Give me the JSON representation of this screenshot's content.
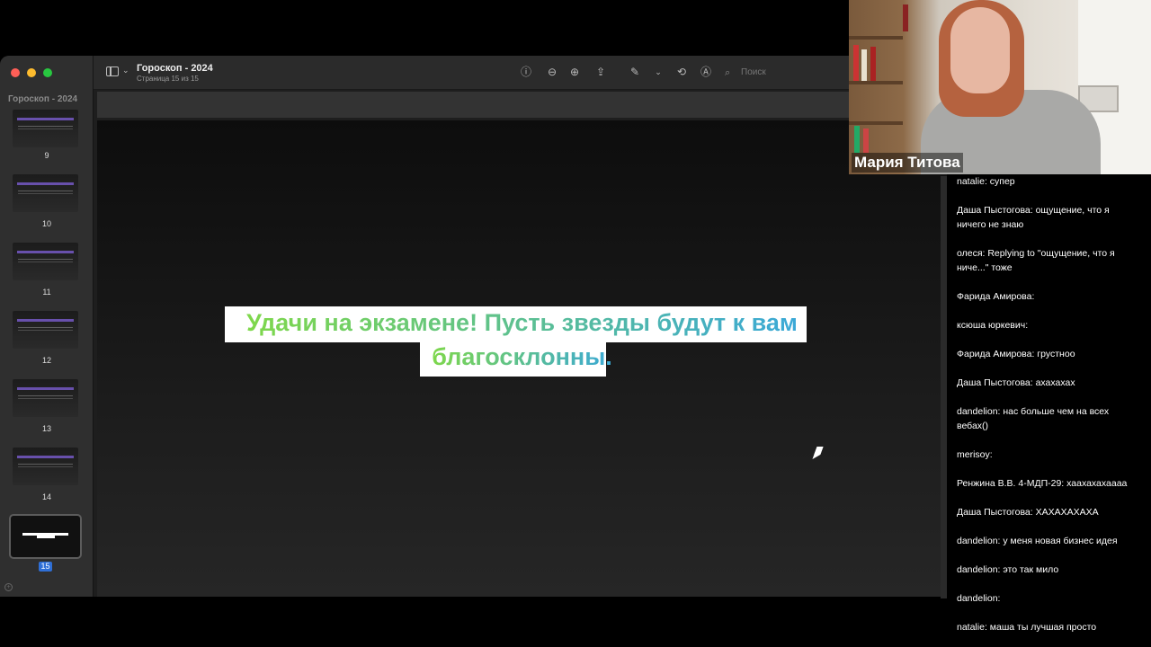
{
  "window": {
    "sidebar_title": "Гороскоп - 2024",
    "doc_title": "Гороскоп - 2024",
    "doc_subtitle": "Страница 15 из 15",
    "search_placeholder": "Поиск"
  },
  "pages": [
    {
      "number": "9"
    },
    {
      "number": "10"
    },
    {
      "number": "11"
    },
    {
      "number": "12"
    },
    {
      "number": "13"
    },
    {
      "number": "14"
    },
    {
      "number": "15"
    }
  ],
  "slide": {
    "line1": "Удачи на экзамене! Пусть звезды будут к вам",
    "line2": "благосклонны."
  },
  "video": {
    "participant_name": "Мария Титова"
  },
  "chat": {
    "messages": [
      {
        "text": "natalie: супер"
      },
      {
        "text": "Даша Пыстогова: ощущение, что я ничего не знаю"
      },
      {
        "text": "олеся: Replying to \"ощущение, что я ниче...\" тоже"
      },
      {
        "text": "Фарида Амирова:"
      },
      {
        "text": "ксюша юркевич:"
      },
      {
        "text": "Фарида Амирова: грустноо"
      },
      {
        "text": "Даша Пыстогова: ахахахах"
      },
      {
        "text": "dandelion: нас больше чем на всех вебах()"
      },
      {
        "text": "merisoy:"
      },
      {
        "text": "Ренжина В.В. 4-МДП-29: хаахахахаааа"
      },
      {
        "text": "Даша Пыстогова: ХАХАХАХАХА"
      },
      {
        "text": "dandelion: у меня новая бизнес идея"
      },
      {
        "text": "dandelion: это так мило"
      },
      {
        "text": "dandelion:"
      },
      {
        "text": "natalie: маша ты лучшая просто"
      }
    ]
  },
  "colors": {
    "accent": "#2f6fd6",
    "text_gradient_start": "#7fd84a",
    "text_gradient_end": "#3aa8d8"
  }
}
